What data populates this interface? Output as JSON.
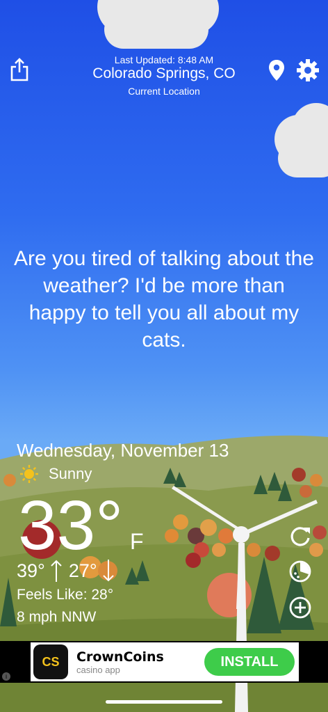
{
  "header": {
    "last_updated": "Last Updated: 8:48 AM",
    "city": "Colorado Springs, CO",
    "location_label": "Current Location"
  },
  "icons": {
    "share": "share-icon",
    "location": "location-pin-icon",
    "settings": "gear-icon",
    "refresh": "refresh-icon",
    "radar": "radar-icon",
    "add": "add-icon",
    "condition": "sun-icon",
    "info": "info-icon"
  },
  "message": "Are you tired of talking about the weather? I'd be more than happy to tell you all about my cats.",
  "weather": {
    "date": "Wednesday, November 13",
    "condition": "Sunny",
    "temperature": "33°",
    "unit": "F",
    "high": "39°",
    "low": "27°",
    "feels_like": "Feels Like: 28°",
    "wind": "8 mph NNW"
  },
  "ad": {
    "logo_text": "CS",
    "app_name": "CrownCoins",
    "subtitle": "casino app",
    "install_label": "INSTALL"
  },
  "colors": {
    "sky_top": "#1f4fe6",
    "install_green": "#3ecc4a"
  }
}
